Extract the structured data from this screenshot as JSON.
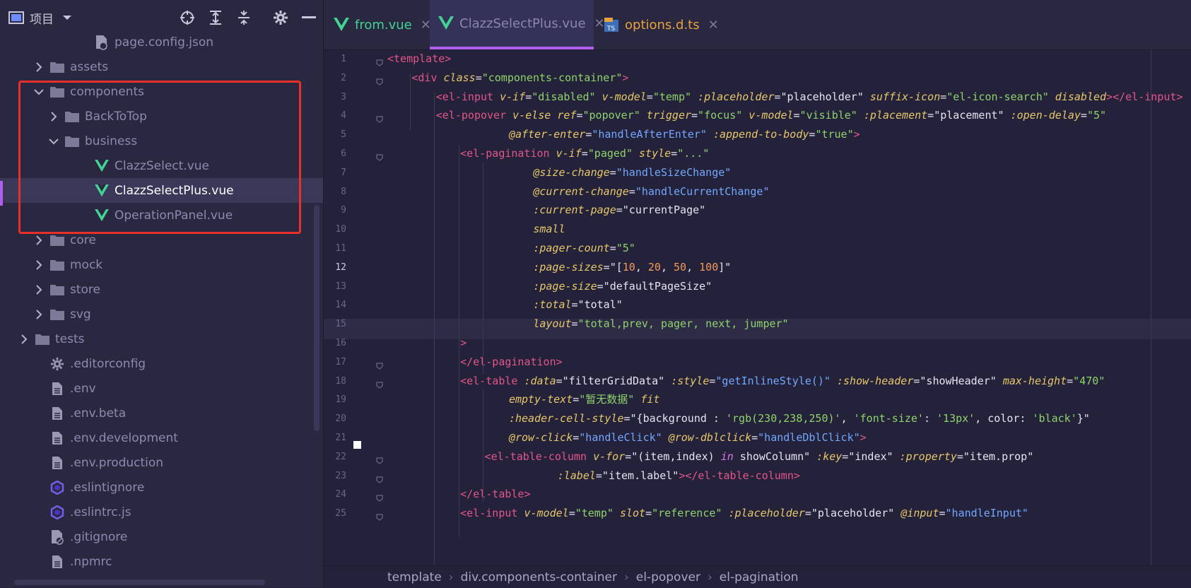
{
  "project_panel": {
    "view_label": "项目",
    "tree": [
      {
        "label": "page.config.json",
        "type": "file-json",
        "indent": 5,
        "chev": "none"
      },
      {
        "label": "assets",
        "type": "folder",
        "indent": 2,
        "chev": "right"
      },
      {
        "label": "components",
        "type": "folder",
        "indent": 2,
        "chev": "down"
      },
      {
        "label": "BackToTop",
        "type": "folder",
        "indent": 3,
        "chev": "right"
      },
      {
        "label": "business",
        "type": "folder",
        "indent": 3,
        "chev": "down"
      },
      {
        "label": "ClazzSelect.vue",
        "type": "vue",
        "indent": 5,
        "chev": "none"
      },
      {
        "label": "ClazzSelectPlus.vue",
        "type": "vue",
        "indent": 5,
        "chev": "none",
        "selected": true
      },
      {
        "label": "OperationPanel.vue",
        "type": "vue",
        "indent": 5,
        "chev": "none"
      },
      {
        "label": "core",
        "type": "folder",
        "indent": 2,
        "chev": "right"
      },
      {
        "label": "mock",
        "type": "folder",
        "indent": 2,
        "chev": "right"
      },
      {
        "label": "store",
        "type": "folder",
        "indent": 2,
        "chev": "right"
      },
      {
        "label": "svg",
        "type": "folder",
        "indent": 2,
        "chev": "right"
      },
      {
        "label": "tests",
        "type": "folder",
        "indent": 1,
        "chev": "right"
      },
      {
        "label": ".editorconfig",
        "type": "gear",
        "indent": 2,
        "chev": "none"
      },
      {
        "label": ".env",
        "type": "file",
        "indent": 2,
        "chev": "none"
      },
      {
        "label": ".env.beta",
        "type": "file",
        "indent": 2,
        "chev": "none"
      },
      {
        "label": ".env.development",
        "type": "file",
        "indent": 2,
        "chev": "none"
      },
      {
        "label": ".env.production",
        "type": "file",
        "indent": 2,
        "chev": "none"
      },
      {
        "label": ".eslintignore",
        "type": "eslint",
        "indent": 2,
        "chev": "none"
      },
      {
        "label": ".eslintrc.js",
        "type": "eslint",
        "indent": 2,
        "chev": "none"
      },
      {
        "label": ".gitignore",
        "type": "file-ignore",
        "indent": 2,
        "chev": "none"
      },
      {
        "label": ".npmrc",
        "type": "file",
        "indent": 2,
        "chev": "none"
      }
    ]
  },
  "tabs": [
    {
      "label": "from.vue",
      "icon": "vue-icon",
      "active": false
    },
    {
      "label": "ClazzSelectPlus.vue",
      "icon": "vue-icon",
      "active": true
    },
    {
      "label": "options.d.ts",
      "icon": "ts-icon",
      "active": false
    }
  ],
  "editor": {
    "current_line": 12,
    "lines": [
      [
        [
          "tag",
          "<template>"
        ]
      ],
      [
        [
          "tag",
          "<div "
        ],
        [
          "attr",
          "class"
        ],
        [
          "p",
          "="
        ],
        [
          "val",
          "\"components-container\""
        ],
        [
          "tag",
          ">"
        ]
      ],
      [
        [
          "tag",
          "<el-input "
        ],
        [
          "attr",
          "v-if"
        ],
        [
          "p",
          "="
        ],
        [
          "val",
          "\"disabled\" "
        ],
        [
          "attr",
          "v-model"
        ],
        [
          "p",
          "="
        ],
        [
          "val",
          "\"temp\" "
        ],
        [
          "attr",
          ":placeholder"
        ],
        [
          "p",
          "=\"placeholder\" "
        ],
        [
          "attr",
          "suffix-icon"
        ],
        [
          "p",
          "="
        ],
        [
          "val",
          "\"el-icon-search\" "
        ],
        [
          "attr",
          "disabled"
        ],
        [
          "tag",
          "></el-input>"
        ]
      ],
      [
        [
          "tag",
          "<el-popover "
        ],
        [
          "attr",
          "v-else ref"
        ],
        [
          "p",
          "="
        ],
        [
          "val",
          "\"popover\" "
        ],
        [
          "attr",
          "trigger"
        ],
        [
          "p",
          "="
        ],
        [
          "val",
          "\"focus\" "
        ],
        [
          "attr",
          "v-model"
        ],
        [
          "p",
          "="
        ],
        [
          "val",
          "\"visible\" "
        ],
        [
          "attr",
          ":placement"
        ],
        [
          "p",
          "=\"placement\" "
        ],
        [
          "attr",
          ":open-delay"
        ],
        [
          "p",
          "="
        ],
        [
          "val",
          "\"5\""
        ]
      ],
      [
        [
          "attr",
          "@after-enter"
        ],
        [
          "p",
          "="
        ],
        [
          "fn",
          "\"handleAfterEnter\" "
        ],
        [
          "attr",
          ":append-to-body"
        ],
        [
          "p",
          "="
        ],
        [
          "val",
          "\"true\""
        ],
        [
          "tag",
          ">"
        ]
      ],
      [
        [
          "tag",
          "<el-pagination "
        ],
        [
          "attr",
          "v-if"
        ],
        [
          "p",
          "="
        ],
        [
          "val",
          "\"paged\" "
        ],
        [
          "attr",
          "style"
        ],
        [
          "p",
          "="
        ],
        [
          "val",
          "\"...\""
        ]
      ],
      [
        [
          "attr",
          "@size-change"
        ],
        [
          "p",
          "="
        ],
        [
          "fn",
          "\"handleSizeChange\""
        ]
      ],
      [
        [
          "attr",
          "@current-change"
        ],
        [
          "p",
          "="
        ],
        [
          "fn",
          "\"handleCurrentChange\""
        ]
      ],
      [
        [
          "attr",
          ":current-page"
        ],
        [
          "p",
          "=\"currentPage\""
        ]
      ],
      [
        [
          "attr",
          "small"
        ]
      ],
      [
        [
          "attr",
          ":pager-count"
        ],
        [
          "p",
          "="
        ],
        [
          "val",
          "\"5\""
        ]
      ],
      [
        [
          "attr",
          ":page-sizes"
        ],
        [
          "p",
          "=\"["
        ],
        [
          "num",
          "10"
        ],
        [
          "p",
          ", "
        ],
        [
          "num",
          "20"
        ],
        [
          "p",
          ", "
        ],
        [
          "num",
          "50"
        ],
        [
          "p",
          ", "
        ],
        [
          "num",
          "100"
        ],
        [
          "p",
          "]\""
        ]
      ],
      [
        [
          "attr",
          ":page-size"
        ],
        [
          "p",
          "=\"defaultPageSize\""
        ]
      ],
      [
        [
          "attr",
          ":total"
        ],
        [
          "p",
          "=\"total\""
        ]
      ],
      [
        [
          "attr",
          "layout"
        ],
        [
          "p",
          "="
        ],
        [
          "val",
          "\"total,prev, pager, next, jumper\""
        ]
      ],
      [
        [
          "tag",
          ">"
        ]
      ],
      [
        [
          "tag",
          "</el-pagination>"
        ]
      ],
      [
        [
          "tag",
          "<el-table "
        ],
        [
          "attr",
          ":data"
        ],
        [
          "p",
          "=\"filterGridData\" "
        ],
        [
          "attr",
          ":style"
        ],
        [
          "p",
          "="
        ],
        [
          "fn",
          "\"getInlineStyle()\" "
        ],
        [
          "attr",
          ":show-header"
        ],
        [
          "p",
          "=\"showHeader\" "
        ],
        [
          "attr",
          "max-height"
        ],
        [
          "p",
          "="
        ],
        [
          "val",
          "\"470\""
        ]
      ],
      [
        [
          "attr",
          "empty-text"
        ],
        [
          "p",
          "="
        ],
        [
          "val",
          "\"暂无数据\" "
        ],
        [
          "attr",
          "fit"
        ]
      ],
      [
        [
          "attr",
          ":header-cell-style"
        ],
        [
          "p",
          "=\"{background : "
        ],
        [
          "val",
          "'rgb(230,238,250)'"
        ],
        [
          "p",
          ", "
        ],
        [
          "val",
          "'font-size'"
        ],
        [
          "p",
          ": "
        ],
        [
          "val",
          "'13px'"
        ],
        [
          "p",
          ", color: "
        ],
        [
          "val",
          "'black'"
        ],
        [
          "p",
          "}\""
        ]
      ],
      [
        [
          "attr",
          "@row-click"
        ],
        [
          "p",
          "="
        ],
        [
          "fn",
          "\"handleClick\" "
        ],
        [
          "attr",
          "@row-dblclick"
        ],
        [
          "p",
          "="
        ],
        [
          "fn",
          "\"handleDblClick\""
        ],
        [
          "tag",
          ">"
        ]
      ],
      [
        [
          "tag",
          "<el-table-column "
        ],
        [
          "attr",
          "v-for"
        ],
        [
          "p",
          "=\"(item,index) "
        ],
        [
          "kw",
          "in"
        ],
        [
          "p",
          " showColumn\" "
        ],
        [
          "attr",
          ":key"
        ],
        [
          "p",
          "=\"index\" "
        ],
        [
          "attr",
          ":property"
        ],
        [
          "p",
          "=\"item.prop\""
        ]
      ],
      [
        [
          "attr",
          ":label"
        ],
        [
          "p",
          "=\"item.label\""
        ],
        [
          "tag",
          "></el-table-column>"
        ]
      ],
      [
        [
          "tag",
          "</el-table>"
        ]
      ],
      [
        [
          "tag",
          "<el-input "
        ],
        [
          "attr",
          "v-model"
        ],
        [
          "p",
          "="
        ],
        [
          "val",
          "\"temp\" "
        ],
        [
          "attr",
          "slot"
        ],
        [
          "p",
          "="
        ],
        [
          "val",
          "\"reference\" "
        ],
        [
          "attr",
          ":placeholder"
        ],
        [
          "p",
          "=\"placeholder\" "
        ],
        [
          "attr",
          "@input"
        ],
        [
          "p",
          "="
        ],
        [
          "fn",
          "\"handleInput\""
        ]
      ]
    ]
  },
  "breadcrumb": [
    "template",
    "div.components-container",
    "el-popover",
    "el-pagination"
  ]
}
